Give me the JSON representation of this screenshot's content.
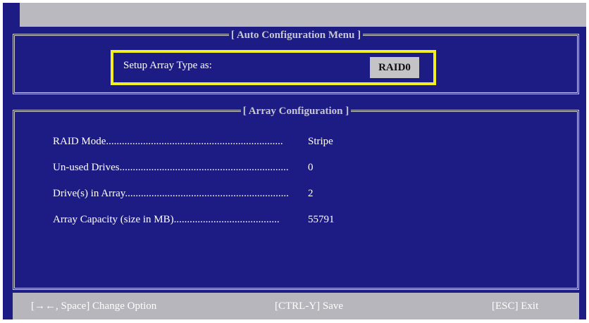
{
  "auto_config": {
    "title": "[ Auto Configuration Menu ]",
    "setup_label": "Setup Array Type as:",
    "array_type_value": "RAID0"
  },
  "array_config": {
    "title": "[ Array Configuration ]",
    "rows": [
      {
        "label": "RAID Mode...................................................................",
        "value": "Stripe"
      },
      {
        "label": "Un-used Drives................................................................",
        "value": "0"
      },
      {
        "label": "Drive(s) in Array..............................................................",
        "value": "2"
      },
      {
        "label": "Array Capacity (size in MB)........................................",
        "value": "55791"
      }
    ]
  },
  "footer": {
    "change_option": "[→←, Space] Change Option",
    "save": "[CTRL-Y] Save",
    "exit": "[ESC] Exit"
  },
  "colors": {
    "background": "#1c1c84",
    "highlight_border": "#f2ef22",
    "bar": "#b9b9bf"
  }
}
